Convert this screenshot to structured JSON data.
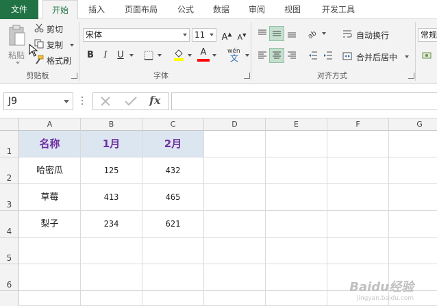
{
  "tabs": [
    "文件",
    "开始",
    "插入",
    "页面布局",
    "公式",
    "数据",
    "审阅",
    "视图",
    "开发工具"
  ],
  "clipboard": {
    "paste": "粘贴",
    "cut": "剪切",
    "copy": "复制",
    "format_painter": "格式刷",
    "label": "剪贴板"
  },
  "font": {
    "name": "宋体",
    "size": "11",
    "bold": "B",
    "italic": "I",
    "underline": "U",
    "wen": "wén",
    "label": "字体",
    "highlight_color": "#ffff00",
    "font_color": "#ff0000"
  },
  "alignment": {
    "wrap": "自动换行",
    "merge": "合并后居中",
    "label": "对齐方式"
  },
  "number": {
    "format": "常规"
  },
  "formula_bar": {
    "name_box": "J9",
    "fx": "fx",
    "value": ""
  },
  "columns": [
    "A",
    "B",
    "C",
    "D",
    "E",
    "F",
    "G"
  ],
  "rows": [
    "1",
    "2",
    "3",
    "4",
    "5",
    "6"
  ],
  "table": {
    "headers": [
      "名称",
      "1月",
      "2月"
    ],
    "rows": [
      [
        "哈密瓜",
        "125",
        "432"
      ],
      [
        "草莓",
        "413",
        "465"
      ],
      [
        "梨子",
        "234",
        "621"
      ]
    ]
  },
  "watermark": {
    "brand": "Baidu经验",
    "url": "jingyan.baidu.com"
  },
  "colors": {
    "accent": "#217346",
    "header_fill": "#dce6f1",
    "header_text": "#7030a0"
  }
}
